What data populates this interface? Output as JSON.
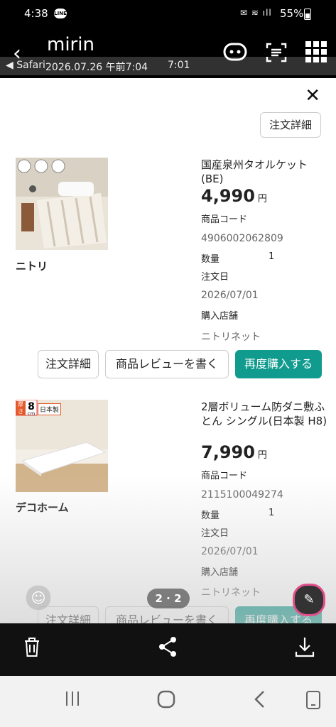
{
  "status": {
    "time": "4:38",
    "notif_icon": "line-notification-icon",
    "battery": "55%"
  },
  "viewer": {
    "chat_name": "mirin",
    "overlay_app": "◀ Safari",
    "overlay_datetime": "2026.07.26 午前7:04",
    "overlay_time2": "7:01",
    "page_indicator": "2 · 2"
  },
  "page": {
    "order_detail_top": "注文詳細",
    "items": [
      {
        "brand": "ニトリ",
        "name": "国産泉州タオルケット(BE)",
        "price": "4,990",
        "yen": "円",
        "code_label": "商品コード",
        "code": "4906002062809",
        "qty_label": "数量",
        "qty": "1",
        "date_label": "注文日",
        "date": "2026/07/01",
        "store_label": "購入店舗",
        "store": "ニトリネット",
        "btn_detail": "注文詳細",
        "btn_review": "商品レビューを書く",
        "btn_rebuy": "再度購入する"
      },
      {
        "brand": "デコホーム",
        "name": "2層ボリューム防ダニ敷ふとん シングル(日本製 H8)",
        "price": "7,990",
        "yen": "円",
        "code_label": "商品コード",
        "code": "2115100049274",
        "qty_label": "数量",
        "qty": "1",
        "date_label": "注文日",
        "date": "2026/07/01",
        "store_label": "購入店舗",
        "store": "ニトリネット",
        "btn_detail": "注文詳細",
        "btn_review": "商品レビューを書く",
        "btn_rebuy": "再度購入する",
        "badge_thickness": "8",
        "badge_unit": "cm",
        "badge_thick_label": "厚さ",
        "badge_madein": "日本製"
      }
    ]
  }
}
